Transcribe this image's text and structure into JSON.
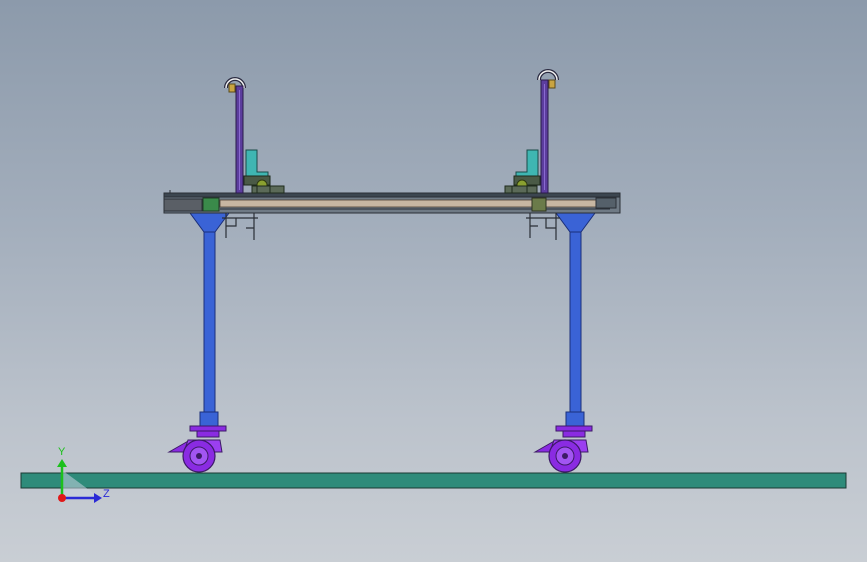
{
  "viewport": {
    "background_top": "#8c9aab",
    "background_bottom": "#c9ced4"
  },
  "model": {
    "colors": {
      "floor": "#2e8b7a",
      "leg": "#3a63d6",
      "caster": "#8a2be2",
      "upright": "#5c3d9e",
      "bracket": "#3fb6b2",
      "beam": "#c7b6a2"
    },
    "parts": [
      "floor-plate",
      "frame-beam",
      "left-leg",
      "right-leg",
      "left-caster",
      "right-caster",
      "left-upright",
      "right-upright"
    ]
  },
  "triad": {
    "y_label": "Y",
    "z_label": "Z",
    "y_color": "#1cc01c",
    "z_color": "#2a2ad6",
    "x_color": "#e01818"
  }
}
